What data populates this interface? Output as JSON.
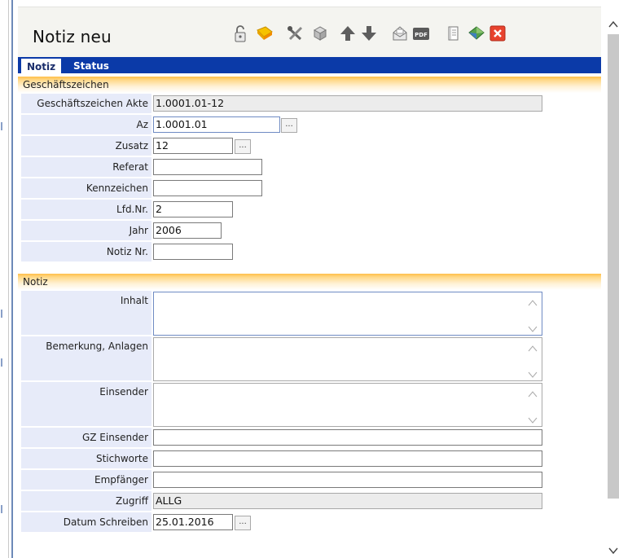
{
  "window": {
    "title": "Notiz  neu"
  },
  "toolbar": {
    "icons": [
      "unlock-icon",
      "save-icon",
      "tools-icon",
      "copy-icon",
      "arrow-up-icon",
      "arrow-down-icon",
      "mail-icon",
      "pdf-icon",
      "document-icon",
      "book-icon",
      "close-icon"
    ],
    "pdf_text": "PDF"
  },
  "tabs": [
    {
      "label": "Notiz",
      "active": true
    },
    {
      "label": "Status",
      "active": false
    }
  ],
  "sections": {
    "geschaeftszeichen": {
      "title": "Geschäftszeichen",
      "fields": {
        "akte": {
          "label": "Geschäftszeichen Akte",
          "value": "1.0001.01-12"
        },
        "az": {
          "label": "Az",
          "value": "1.0001.01"
        },
        "zusatz": {
          "label": "Zusatz",
          "value": "12"
        },
        "referat": {
          "label": "Referat",
          "value": ""
        },
        "kennzeichen": {
          "label": "Kennzeichen",
          "value": ""
        },
        "lfdnr": {
          "label": "Lfd.Nr.",
          "value": "2"
        },
        "jahr": {
          "label": "Jahr",
          "value": "2006"
        },
        "notiznr": {
          "label": "Notiz Nr.",
          "value": ""
        }
      }
    },
    "notiz": {
      "title": "Notiz",
      "fields": {
        "inhalt": {
          "label": "Inhalt",
          "value": ""
        },
        "bemerkung": {
          "label": "Bemerkung, Anlagen",
          "value": ""
        },
        "einsender": {
          "label": "Einsender",
          "value": ""
        },
        "gz_einsender": {
          "label": "GZ Einsender",
          "value": ""
        },
        "stichworte": {
          "label": "Stichworte",
          "value": ""
        },
        "empfaenger": {
          "label": "Empfänger",
          "value": ""
        },
        "zugriff": {
          "label": "Zugriff",
          "value": "ALLG"
        },
        "datum": {
          "label": "Datum Schreiben",
          "value": "25.01.2016"
        }
      }
    }
  },
  "lookup_button": "...",
  "colors": {
    "tabbar": "#0b3aa8",
    "section": "#ffbf4a",
    "label_bg": "#e7ebf9"
  }
}
